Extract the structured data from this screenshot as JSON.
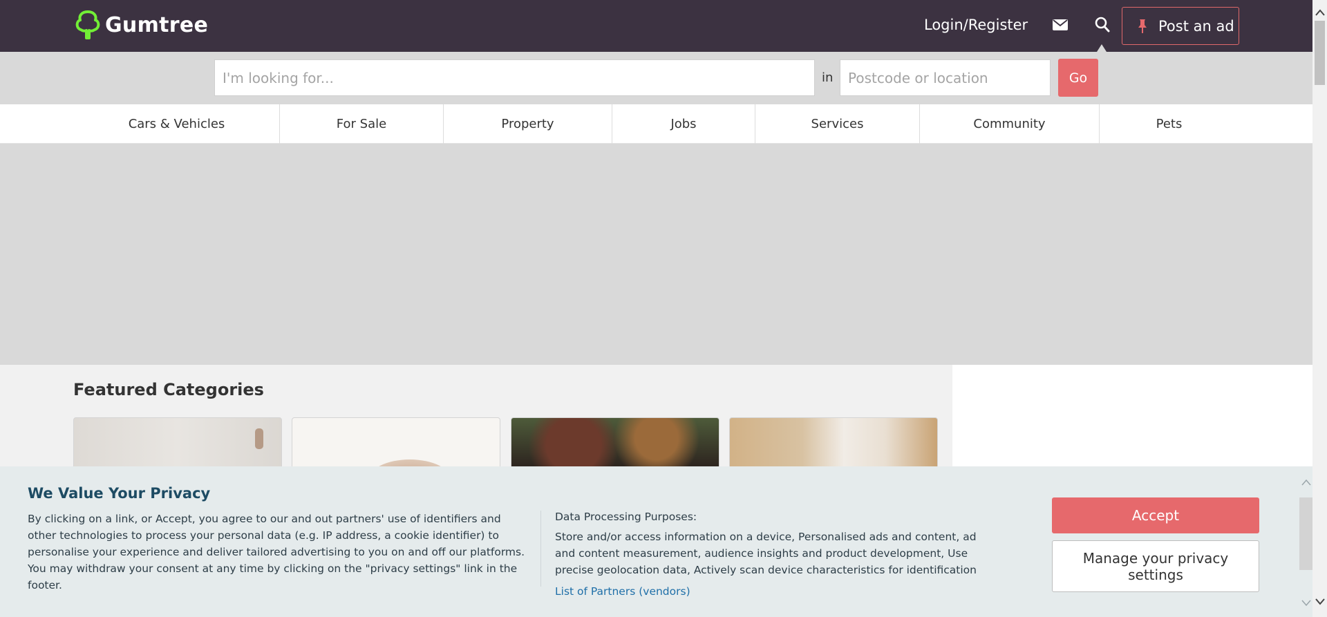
{
  "header": {
    "logo_text": "Gumtree",
    "login_label": "Login/Register",
    "post_ad_label": "Post an ad"
  },
  "search": {
    "query_placeholder": "I'm looking for...",
    "in_label": "in",
    "location_placeholder": "Postcode or location",
    "go_label": "Go"
  },
  "categories": [
    "Cars & Vehicles",
    "For Sale",
    "Property",
    "Jobs",
    "Services",
    "Community",
    "Pets"
  ],
  "featured": {
    "title": "Featured Categories"
  },
  "privacy": {
    "title": "We Value Your Privacy",
    "body": "By clicking on a link, or Accept, you agree to our and out partners' use of identifiers and other technologies to process your personal data (e.g. IP address, a cookie identifier) to personalise your experience and deliver tailored advertising to you on and off our platforms. You may withdraw your consent at any time by clicking on the \"privacy settings\" link in the footer.",
    "purposes_title": "Data Processing Purposes:",
    "purposes": "Store and/or access information on a device, Personalised ads and content, ad and content measurement, audience insights and product development, Use precise geolocation data, Actively scan device characteristics for identification",
    "partners_link": "List of Partners (vendors)",
    "accept_label": "Accept",
    "manage_label": "Manage your privacy settings"
  },
  "colors": {
    "header_bg": "#3c3241",
    "accent": "#e6696c",
    "logo_green": "#72ef36",
    "privacy_title": "#1d4b63",
    "link": "#1f6fa8"
  },
  "icons": [
    "tree-logo-icon",
    "mail-icon",
    "search-icon",
    "pin-icon",
    "chevron-up-icon",
    "chevron-down-icon"
  ]
}
